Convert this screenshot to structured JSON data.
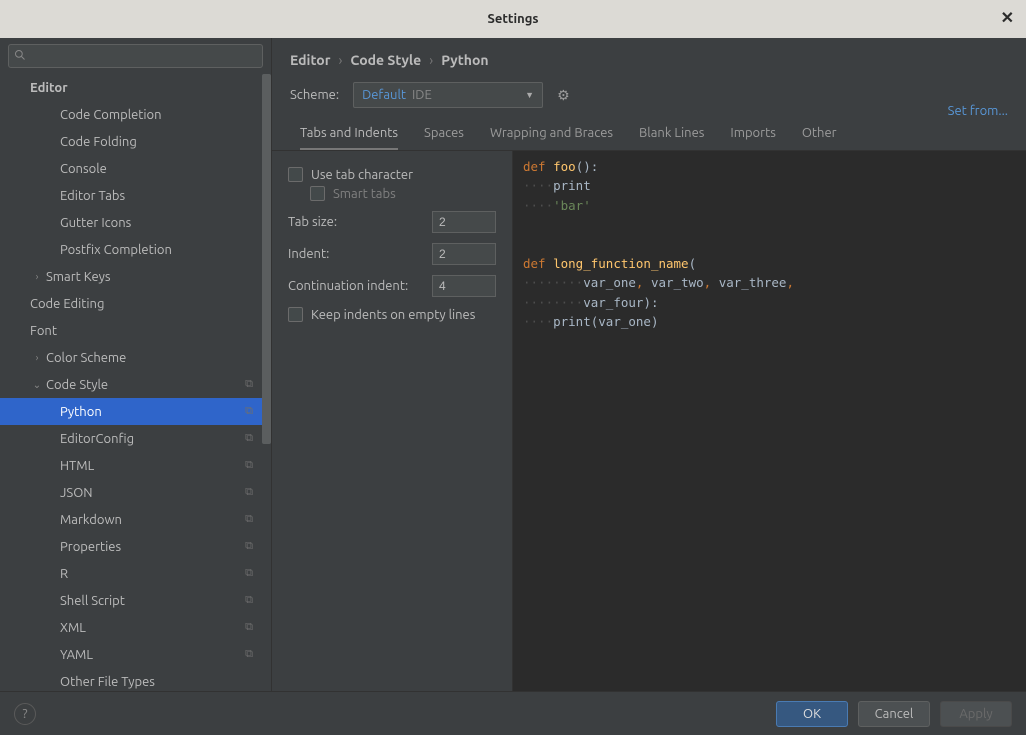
{
  "window": {
    "title": "Settings"
  },
  "search": {
    "placeholder": ""
  },
  "sidebar": {
    "section": "Editor",
    "items": [
      {
        "label": "Code Completion",
        "level": 2
      },
      {
        "label": "Code Folding",
        "level": 2
      },
      {
        "label": "Console",
        "level": 2
      },
      {
        "label": "Editor Tabs",
        "level": 2
      },
      {
        "label": "Gutter Icons",
        "level": 2
      },
      {
        "label": "Postfix Completion",
        "level": 2
      },
      {
        "label": "Smart Keys",
        "level": 1,
        "expandable": true,
        "chev": "›"
      },
      {
        "label": "Code Editing",
        "level": 1
      },
      {
        "label": "Font",
        "level": 1
      },
      {
        "label": "Color Scheme",
        "level": 1,
        "expandable": true,
        "chev": "›"
      },
      {
        "label": "Code Style",
        "level": 1,
        "expandable": true,
        "chev": "⌄",
        "copy": true
      },
      {
        "label": "Python",
        "level": 2,
        "selected": true,
        "copy": true
      },
      {
        "label": "EditorConfig",
        "level": 2,
        "copy": true
      },
      {
        "label": "HTML",
        "level": 2,
        "copy": true
      },
      {
        "label": "JSON",
        "level": 2,
        "copy": true
      },
      {
        "label": "Markdown",
        "level": 2,
        "copy": true
      },
      {
        "label": "Properties",
        "level": 2,
        "copy": true
      },
      {
        "label": "R",
        "level": 2,
        "copy": true
      },
      {
        "label": "Shell Script",
        "level": 2,
        "copy": true
      },
      {
        "label": "XML",
        "level": 2,
        "copy": true
      },
      {
        "label": "YAML",
        "level": 2,
        "copy": true
      },
      {
        "label": "Other File Types",
        "level": 2
      }
    ]
  },
  "breadcrumb": {
    "a": "Editor",
    "b": "Code Style",
    "c": "Python"
  },
  "scheme": {
    "label": "Scheme:",
    "name": "Default",
    "tag": "IDE",
    "setfrom": "Set from..."
  },
  "tabs": [
    {
      "label": "Tabs and Indents",
      "active": true
    },
    {
      "label": "Spaces"
    },
    {
      "label": "Wrapping and Braces"
    },
    {
      "label": "Blank Lines"
    },
    {
      "label": "Imports"
    },
    {
      "label": "Other"
    }
  ],
  "form": {
    "use_tab": "Use tab character",
    "smart_tabs": "Smart tabs",
    "tab_size_label": "Tab size:",
    "tab_size": "2",
    "indent_label": "Indent:",
    "indent": "2",
    "cont_label": "Continuation indent:",
    "cont": "4",
    "keep_empty": "Keep indents on empty lines"
  },
  "preview": {
    "l1_def": "def ",
    "l1_fn": "foo",
    "l1_rest": "():",
    "l2_ws": "····",
    "l2": "print",
    "l3_ws": "····",
    "l3_str": "'bar'",
    "l4": "",
    "l5": "",
    "l6_def": "def ",
    "l6_fn": "long_function_name",
    "l6_rest": "(",
    "l7_ws": "········",
    "l7a": "var_one",
    "l7c": ", ",
    "l7b": "var_two",
    "l7d": ", ",
    "l7e": "var_three",
    "l7f": ",",
    "l8_ws": "········",
    "l8a": "var_four",
    "l8b": "):",
    "l9_ws": "····",
    "l9": "print(var_one)"
  },
  "footer": {
    "ok": "OK",
    "cancel": "Cancel",
    "apply": "Apply"
  }
}
